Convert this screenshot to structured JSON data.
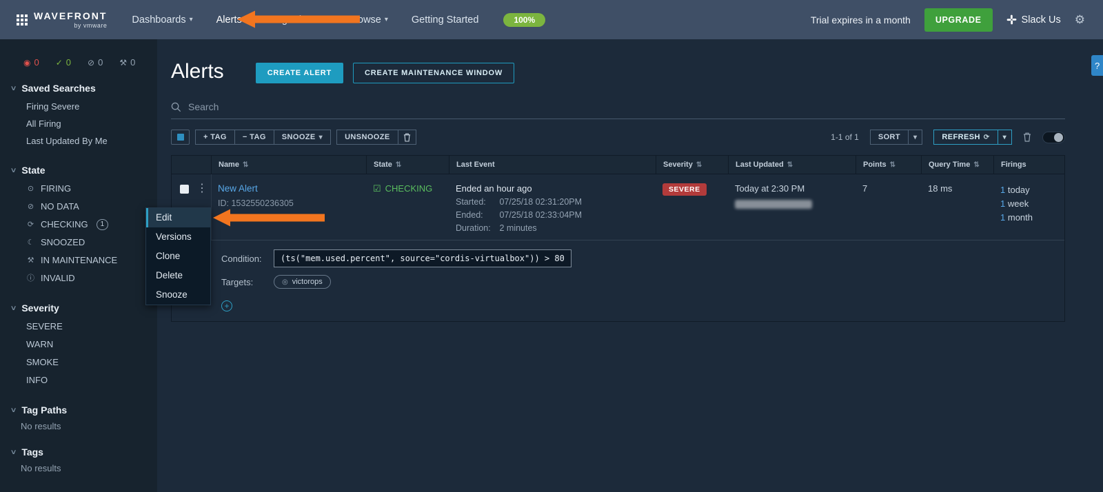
{
  "navbar": {
    "logo_title": "WAVEFRONT",
    "logo_subtitle": "by vmware",
    "items": [
      {
        "label": "Dashboards"
      },
      {
        "label": "Alerts"
      },
      {
        "label": "Integrations"
      },
      {
        "label": "Browse"
      },
      {
        "label": "Getting Started"
      }
    ],
    "progress_badge": "100%",
    "trial_text": "Trial expires in a month",
    "upgrade_label": "UPGRADE",
    "slack_label": "Slack Us"
  },
  "sidebar": {
    "counters": [
      {
        "name": "firing",
        "value": "0"
      },
      {
        "name": "ok",
        "value": "0"
      },
      {
        "name": "snoozed",
        "value": "0"
      },
      {
        "name": "maintenance",
        "value": "0"
      }
    ],
    "saved_searches": {
      "title": "Saved Searches",
      "items": [
        "Firing Severe",
        "All Firing",
        "Last Updated By Me"
      ]
    },
    "state": {
      "title": "State",
      "items": [
        {
          "label": "FIRING"
        },
        {
          "label": "NO DATA"
        },
        {
          "label": "CHECKING",
          "badge": "1"
        },
        {
          "label": "SNOOZED"
        },
        {
          "label": "IN MAINTENANCE"
        },
        {
          "label": "INVALID"
        }
      ]
    },
    "severity": {
      "title": "Severity",
      "items": [
        "SEVERE",
        "WARN",
        "SMOKE",
        "INFO"
      ]
    },
    "tag_paths": {
      "title": "Tag Paths",
      "empty": "No results"
    },
    "tags": {
      "title": "Tags",
      "empty": "No results"
    }
  },
  "main": {
    "title": "Alerts",
    "create_alert": "CREATE ALERT",
    "create_mw": "CREATE MAINTENANCE WINDOW",
    "help_label": "?",
    "search_placeholder": "Search",
    "toolbar": {
      "add_tag": "+ TAG",
      "remove_tag": "− TAG",
      "snooze": "SNOOZE",
      "unsnooze": "UNSNOOZE",
      "range": "1-1 of 1",
      "sort": "SORT",
      "refresh": "REFRESH"
    },
    "table": {
      "columns": [
        {
          "label": "Name"
        },
        {
          "label": "State"
        },
        {
          "label": "Last Event"
        },
        {
          "label": "Severity"
        },
        {
          "label": "Last Updated"
        },
        {
          "label": "Points"
        },
        {
          "label": "Query Time"
        },
        {
          "label": "Firings"
        }
      ],
      "row": {
        "name": "New Alert",
        "id_label": "ID:",
        "id_value": "1532550236305",
        "state": "CHECKING",
        "event_headline": "Ended an hour ago",
        "event_details": [
          {
            "label": "Started:",
            "value": "07/25/18 02:31:20PM"
          },
          {
            "label": "Ended:",
            "value": "07/25/18 02:33:04PM"
          },
          {
            "label": "Duration:",
            "value": "2 minutes"
          }
        ],
        "severity": "SEVERE",
        "last_updated": "Today at 2:30 PM",
        "points": "7",
        "query_time": "18 ms",
        "firings": [
          {
            "count": "1",
            "unit": "today"
          },
          {
            "count": "1",
            "unit": "week"
          },
          {
            "count": "1",
            "unit": "month"
          }
        ],
        "condition_label": "Condition:",
        "condition": "(ts(\"mem.used.percent\", source=\"cordis-virtualbox\")) > 80",
        "targets_label": "Targets:",
        "target": "victorops"
      }
    },
    "context_menu": {
      "items": [
        "Edit",
        "Versions",
        "Clone",
        "Delete",
        "Snooze"
      ],
      "active": "Edit"
    }
  },
  "icons": {
    "caret_down": "▾",
    "chevron_down": "∨",
    "gear": "⚙",
    "sort": "⇅",
    "kebab": "⋮",
    "check_square": "☑",
    "refresh": "⟳",
    "plus": "+",
    "counter_firing": "◉",
    "counter_ok": "✓",
    "counter_snoozed": "⊘",
    "counter_maintenance": "⚒",
    "state_firing": "⊙",
    "state_nodata": "⊘",
    "state_checking": "⟳",
    "state_snoozed": "☾",
    "state_maintenance": "⚒",
    "state_invalid": "ⓘ",
    "target": "◎"
  },
  "colors": {
    "accent_teal": "#1E9CC0",
    "link_blue": "#58A8E8",
    "severe_red": "#B23B3B",
    "checking_green": "#5ABE5E",
    "upgrade_green": "#3FA03C",
    "progress_green": "#7CB53F",
    "arrow_orange": "#F2751F"
  }
}
